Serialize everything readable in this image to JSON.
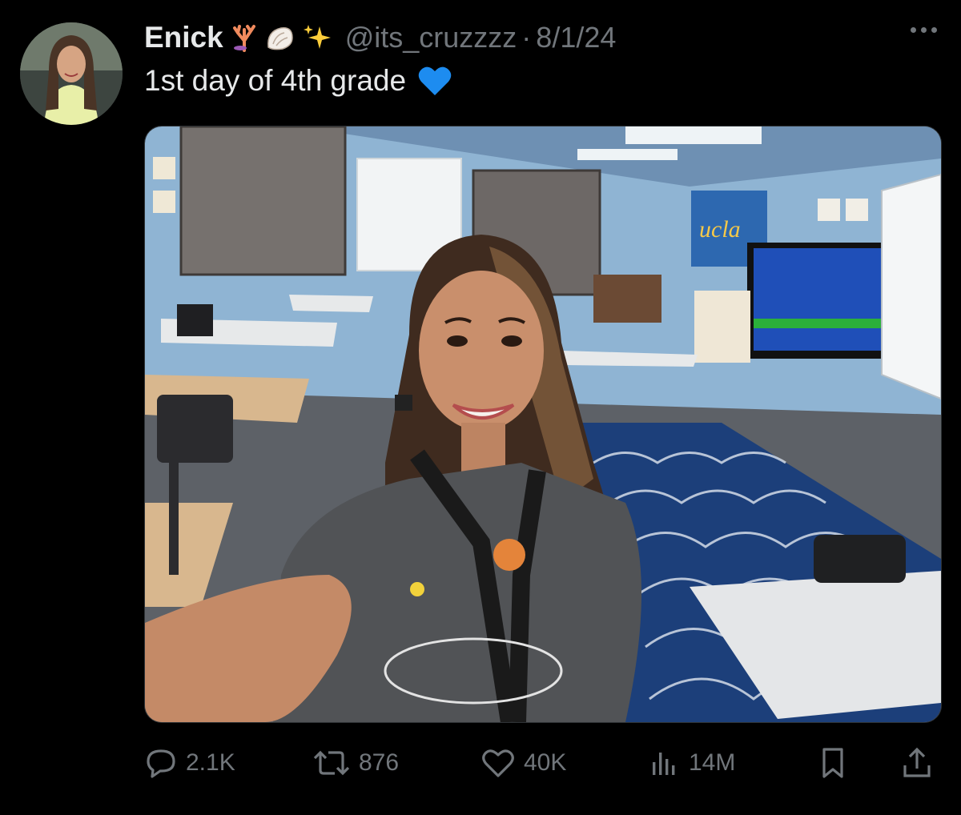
{
  "author": {
    "name": "Enick",
    "emojis": [
      "coral-icon",
      "shell-icon",
      "sparkles-icon"
    ],
    "handle": "@its_cruzzzz",
    "separator": "·",
    "date": "8/1/24"
  },
  "tweet": {
    "text": "1st day of 4th grade",
    "emoji": "blue-heart-icon"
  },
  "actions": {
    "replies": "2.1K",
    "reposts": "876",
    "likes": "40K",
    "views": "14M"
  },
  "colors": {
    "background": "#000000",
    "text": "#e7e9ea",
    "muted": "#71767b",
    "wall": "#8fb4d3",
    "rug": "#1c3f7a",
    "heart": "#1d8cf0"
  }
}
